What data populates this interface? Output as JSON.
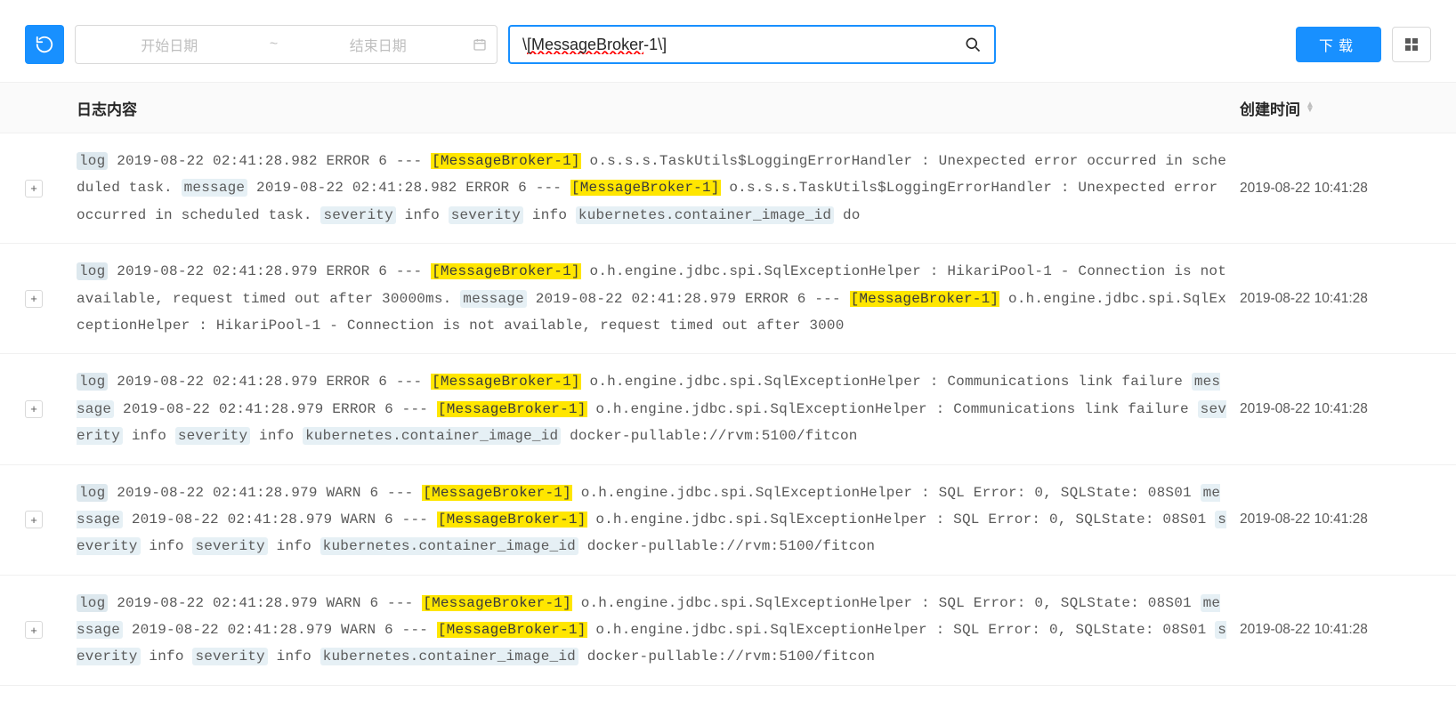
{
  "toolbar": {
    "date_start_placeholder": "开始日期",
    "date_sep": "~",
    "date_end_placeholder": "结束日期",
    "search_value": "\\[MessageBroker-1\\]",
    "download_label": "下载"
  },
  "headers": {
    "content": "日志内容",
    "time": "创建时间"
  },
  "rows": [
    {
      "time": "2019-08-22 10:41:28",
      "segments": [
        {
          "t": "key",
          "klass": "key-first",
          "v": "log"
        },
        {
          "t": "text",
          "v": " 2019-08-22 02:41:28.982 ERROR 6 --- "
        },
        {
          "t": "hl",
          "v": "[MessageBroker-1]"
        },
        {
          "t": "text",
          "v": " o.s.s.s.TaskUtils$LoggingErrorHandler : Unexpected error occurred in scheduled task. "
        },
        {
          "t": "key",
          "v": "message"
        },
        {
          "t": "text",
          "v": " 2019-08-22 02:41:28.982 ERROR 6 --- "
        },
        {
          "t": "hl",
          "v": "[MessageBroker-1]"
        },
        {
          "t": "text",
          "v": " o.s.s.s.TaskUtils$LoggingErrorHandler : Unexpected error occurred in scheduled task. "
        },
        {
          "t": "key",
          "v": "severity"
        },
        {
          "t": "text",
          "v": " info "
        },
        {
          "t": "key",
          "v": "severity"
        },
        {
          "t": "text",
          "v": " info "
        },
        {
          "t": "key",
          "v": "kubernetes.container_image_id"
        },
        {
          "t": "text",
          "v": " do"
        }
      ]
    },
    {
      "time": "2019-08-22 10:41:28",
      "segments": [
        {
          "t": "key",
          "klass": "key-first",
          "v": "log"
        },
        {
          "t": "text",
          "v": " 2019-08-22 02:41:28.979 ERROR 6 --- "
        },
        {
          "t": "hl",
          "v": "[MessageBroker-1]"
        },
        {
          "t": "text",
          "v": " o.h.engine.jdbc.spi.SqlExceptionHelper : HikariPool-1 - Connection is not available, request timed out after 30000ms. "
        },
        {
          "t": "key",
          "v": "message"
        },
        {
          "t": "text",
          "v": " 2019-08-22 02:41:28.979 ERROR 6 --- "
        },
        {
          "t": "hl",
          "v": "[MessageBroker-1]"
        },
        {
          "t": "text",
          "v": " o.h.engine.jdbc.spi.SqlExceptionHelper : HikariPool-1 - Connection is not available, request timed out after 3000"
        }
      ]
    },
    {
      "time": "2019-08-22 10:41:28",
      "segments": [
        {
          "t": "key",
          "klass": "key-first",
          "v": "log"
        },
        {
          "t": "text",
          "v": " 2019-08-22 02:41:28.979 ERROR 6 --- "
        },
        {
          "t": "hl",
          "v": "[MessageBroker-1]"
        },
        {
          "t": "text",
          "v": " o.h.engine.jdbc.spi.SqlExceptionHelper : Communications link failure "
        },
        {
          "t": "key",
          "v": "message"
        },
        {
          "t": "text",
          "v": " 2019-08-22 02:41:28.979 ERROR 6 --- "
        },
        {
          "t": "hl",
          "v": "[MessageBroker-1]"
        },
        {
          "t": "text",
          "v": " o.h.engine.jdbc.spi.SqlExceptionHelper : Communications link failure "
        },
        {
          "t": "key",
          "v": "severity"
        },
        {
          "t": "text",
          "v": " info "
        },
        {
          "t": "key",
          "v": "severity"
        },
        {
          "t": "text",
          "v": " info "
        },
        {
          "t": "key",
          "v": "kubernetes.container_image_id"
        },
        {
          "t": "text",
          "v": " docker-pullable://rvm:5100/fitcon"
        }
      ]
    },
    {
      "time": "2019-08-22 10:41:28",
      "segments": [
        {
          "t": "key",
          "klass": "key-first",
          "v": "log"
        },
        {
          "t": "text",
          "v": " 2019-08-22 02:41:28.979 WARN 6 --- "
        },
        {
          "t": "hl",
          "v": "[MessageBroker-1]"
        },
        {
          "t": "text",
          "v": " o.h.engine.jdbc.spi.SqlExceptionHelper : SQL Error: 0, SQLState: 08S01 "
        },
        {
          "t": "key",
          "v": "message"
        },
        {
          "t": "text",
          "v": " 2019-08-22 02:41:28.979 WARN 6 --- "
        },
        {
          "t": "hl",
          "v": "[MessageBroker-1]"
        },
        {
          "t": "text",
          "v": " o.h.engine.jdbc.spi.SqlExceptionHelper : SQL Error: 0, SQLState: 08S01 "
        },
        {
          "t": "key",
          "v": "severity"
        },
        {
          "t": "text",
          "v": " info "
        },
        {
          "t": "key",
          "v": "severity"
        },
        {
          "t": "text",
          "v": " info "
        },
        {
          "t": "key",
          "v": "kubernetes.container_image_id"
        },
        {
          "t": "text",
          "v": " docker-pullable://rvm:5100/fitcon"
        }
      ]
    },
    {
      "time": "2019-08-22 10:41:28",
      "segments": [
        {
          "t": "key",
          "klass": "key-first",
          "v": "log"
        },
        {
          "t": "text",
          "v": " 2019-08-22 02:41:28.979 WARN 6 --- "
        },
        {
          "t": "hl",
          "v": "[MessageBroker-1]"
        },
        {
          "t": "text",
          "v": " o.h.engine.jdbc.spi.SqlExceptionHelper : SQL Error: 0, SQLState: 08S01 "
        },
        {
          "t": "key",
          "v": "message"
        },
        {
          "t": "text",
          "v": " 2019-08-22 02:41:28.979 WARN 6 --- "
        },
        {
          "t": "hl",
          "v": "[MessageBroker-1]"
        },
        {
          "t": "text",
          "v": " o.h.engine.jdbc.spi.SqlExceptionHelper : SQL Error: 0, SQLState: 08S01 "
        },
        {
          "t": "key",
          "v": "severity"
        },
        {
          "t": "text",
          "v": " info "
        },
        {
          "t": "key",
          "v": "severity"
        },
        {
          "t": "text",
          "v": " info "
        },
        {
          "t": "key",
          "v": "kubernetes.container_image_id"
        },
        {
          "t": "text",
          "v": " docker-pullable://rvm:5100/fitcon"
        }
      ]
    }
  ]
}
